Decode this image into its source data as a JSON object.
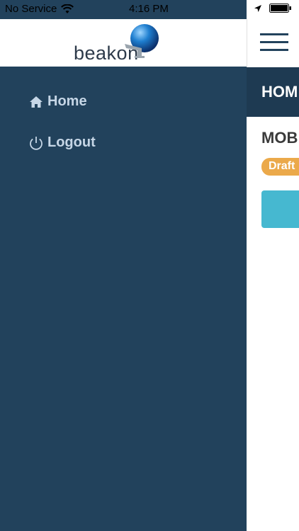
{
  "status_bar": {
    "carrier": "No Service",
    "time": "4:16 PM"
  },
  "drawer": {
    "logo_text": "beakon",
    "menu": [
      {
        "label": "Home",
        "icon": "home-icon"
      },
      {
        "label": "Logout",
        "icon": "power-icon"
      }
    ]
  },
  "page": {
    "title": "HOM",
    "section_title": "MOB",
    "badge": "Draft"
  },
  "colors": {
    "drawer_bg": "#22425c",
    "menu_text": "#c6d6e6",
    "title_bar": "#1e3a52",
    "badge": "#eba94a",
    "button": "#46b8d0"
  }
}
